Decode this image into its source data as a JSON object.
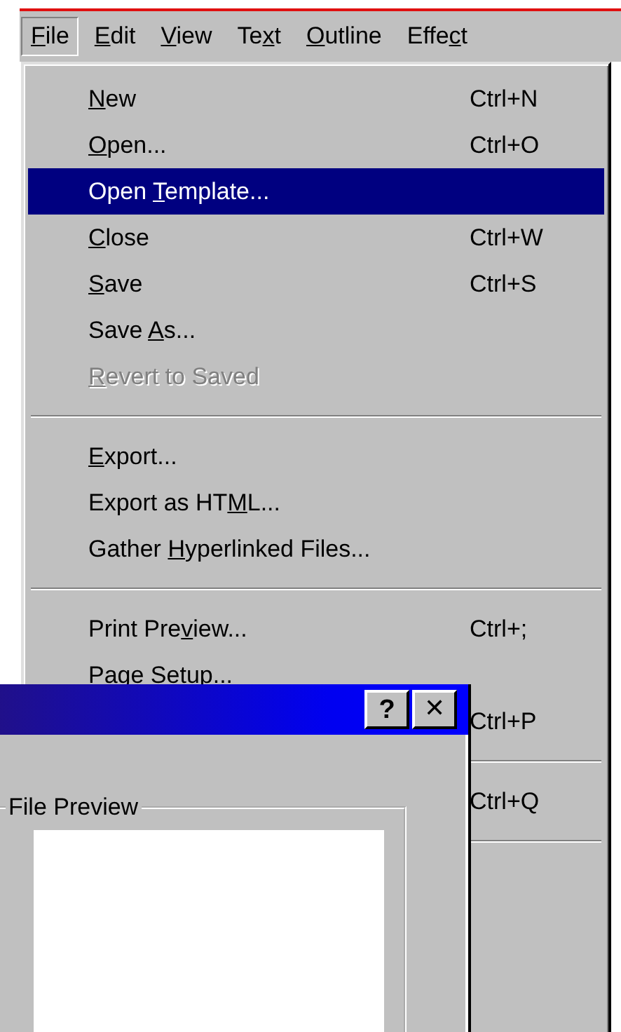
{
  "menubar": [
    {
      "label": {
        "key": "F",
        "post": "ile"
      },
      "selected": true
    },
    {
      "label": {
        "key": "E",
        "post": "dit"
      },
      "selected": false
    },
    {
      "label": {
        "key": "V",
        "post": "iew"
      },
      "selected": false
    },
    {
      "label": {
        "pre": "Te",
        "key": "x",
        "post": "t"
      },
      "selected": false
    },
    {
      "label": {
        "key": "O",
        "post": "utline"
      },
      "selected": false
    },
    {
      "label": {
        "pre": "Effe",
        "key": "c",
        "post": "t"
      },
      "selected": false
    }
  ],
  "file_menu": [
    {
      "kind": "item",
      "label": {
        "key": "N",
        "post": "ew"
      },
      "shortcut": "Ctrl+N",
      "selected": false,
      "disabled": false
    },
    {
      "kind": "item",
      "label": {
        "key": "O",
        "post": "pen..."
      },
      "shortcut": "Ctrl+O",
      "selected": false,
      "disabled": false
    },
    {
      "kind": "item",
      "label": {
        "pre": "Open ",
        "key": "T",
        "post": "emplate..."
      },
      "selected": true,
      "disabled": false
    },
    {
      "kind": "item",
      "label": {
        "key": "C",
        "post": "lose"
      },
      "shortcut": "Ctrl+W",
      "selected": false,
      "disabled": false
    },
    {
      "kind": "item",
      "label": {
        "key": "S",
        "post": "ave"
      },
      "shortcut": "Ctrl+S",
      "selected": false,
      "disabled": false
    },
    {
      "kind": "item",
      "label": {
        "pre": "Save ",
        "key": "A",
        "post": "s..."
      },
      "selected": false,
      "disabled": false
    },
    {
      "kind": "item",
      "label": {
        "key": "R",
        "post": "evert to Saved"
      },
      "selected": false,
      "disabled": true
    },
    {
      "kind": "separator"
    },
    {
      "kind": "item",
      "label": {
        "key": "E",
        "post": "xport..."
      },
      "selected": false,
      "disabled": false
    },
    {
      "kind": "item",
      "label": {
        "pre": "Export as HT",
        "key": "M",
        "post": "L..."
      },
      "selected": false,
      "disabled": false
    },
    {
      "kind": "item",
      "label": {
        "pre": "Gather ",
        "key": "H",
        "post": "yperlinked Files..."
      },
      "selected": false,
      "disabled": false
    },
    {
      "kind": "separator"
    },
    {
      "kind": "item",
      "label": {
        "pre": "Print Pre",
        "key": "v",
        "post": "iew..."
      },
      "shortcut": "Ctrl+;",
      "selected": false,
      "disabled": false
    },
    {
      "kind": "item",
      "label": {
        "pre": "Page Setup..."
      },
      "selected": false,
      "disabled": false
    },
    {
      "kind": "item",
      "shortcut": "Ctrl+P",
      "selected": false,
      "disabled": false
    },
    {
      "kind": "separator"
    },
    {
      "kind": "item",
      "shortcut": "Ctrl+Q",
      "selected": false,
      "disabled": false
    },
    {
      "kind": "separator"
    }
  ],
  "dialog": {
    "title_buttons": [
      {
        "kind": "help",
        "label": "?"
      },
      {
        "kind": "close",
        "label": "✕"
      }
    ],
    "preview_group": {
      "label": "File Preview"
    }
  }
}
